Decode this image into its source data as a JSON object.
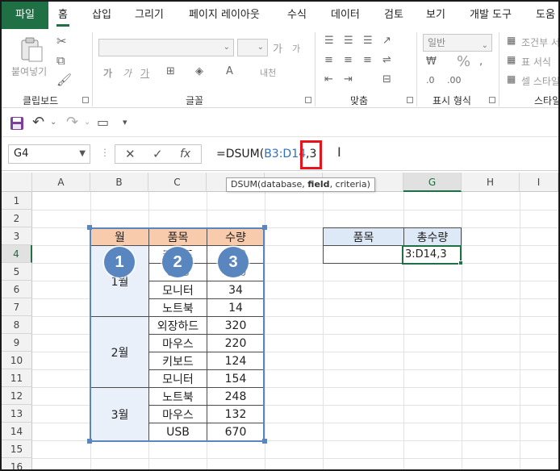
{
  "tabs": [
    "파일",
    "홈",
    "삽입",
    "그리기",
    "페이지 레이아웃",
    "수식",
    "데이터",
    "검토",
    "보기",
    "개발 도구",
    "도움"
  ],
  "active_tab": "홈",
  "ribbon": {
    "clipboard": {
      "paste_label": "붙여넣기",
      "group_label": "클립보드"
    },
    "font": {
      "group_label": "글꼴",
      "size_grow": "가",
      "size_shrink": "가",
      "bold": "가",
      "italic": "가",
      "underline": "가",
      "phonetic": "내천"
    },
    "alignment": {
      "group_label": "맞춤"
    },
    "number": {
      "format_value": "일반",
      "group_label": "표시 형식",
      "percent": "%"
    },
    "styles": {
      "cond_format": "조건부 서",
      "format_table": "표 서식",
      "cell_style": "셀 스타일",
      "group_label": "스타일"
    }
  },
  "namebox": {
    "value": "G4"
  },
  "formula": {
    "prefix": "=DSUM(",
    "ref": "B3:D14",
    "suffix": ",3"
  },
  "tooltip": {
    "fn": "DSUM(",
    "arg1": "database, ",
    "arg2_bold": "field",
    "arg3": ", criteria)"
  },
  "columns": [
    "A",
    "B",
    "C",
    "D",
    "E",
    "F",
    "G",
    "H",
    "I"
  ],
  "rows": [
    "1",
    "2",
    "3",
    "4",
    "5",
    "6",
    "7",
    "8",
    "9",
    "10",
    "11",
    "12",
    "13",
    "14",
    "15",
    "16"
  ],
  "table": {
    "headers": [
      "월",
      "품목",
      "수량"
    ],
    "months": [
      "1월",
      "2월",
      "3월"
    ],
    "rows": [
      {
        "item": "키보드",
        "qty": "120"
      },
      {
        "item": "USB",
        "qty": "330"
      },
      {
        "item": "모니터",
        "qty": "34"
      },
      {
        "item": "노트북",
        "qty": "14"
      },
      {
        "item": "외장하드",
        "qty": "320"
      },
      {
        "item": "마우스",
        "qty": "220"
      },
      {
        "item": "키보드",
        "qty": "124"
      },
      {
        "item": "모니터",
        "qty": "154"
      },
      {
        "item": "노트북",
        "qty": "248"
      },
      {
        "item": "마우스",
        "qty": "132"
      },
      {
        "item": "USB",
        "qty": "670"
      }
    ]
  },
  "criteria": {
    "headers": [
      "품목",
      "총수량"
    ],
    "active_value": "3:D14,3"
  },
  "badges": [
    "1",
    "2",
    "3"
  ],
  "colors": {
    "excel_green": "#1f7145",
    "header_peach": "#f8cbad",
    "header_blue": "#dde9f7",
    "badge_blue": "#5a86c0",
    "highlight_red": "#e8141c"
  }
}
